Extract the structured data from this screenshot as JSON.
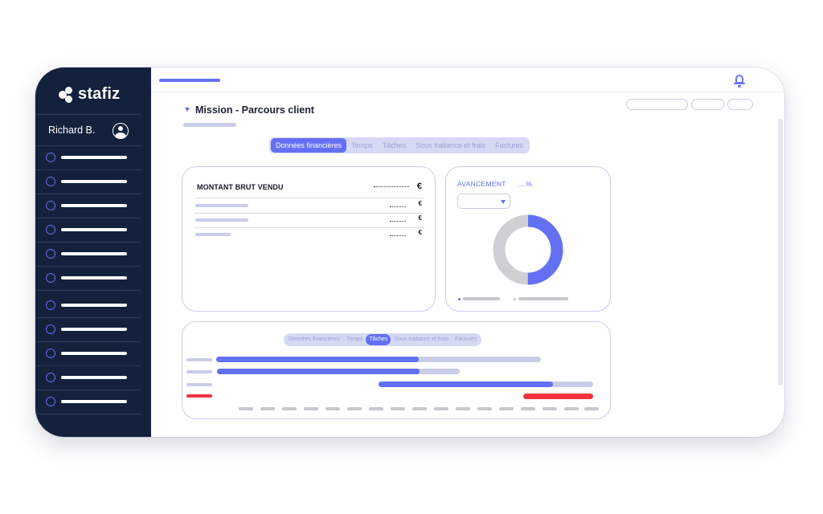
{
  "app": {
    "logo_text": "stafiz"
  },
  "user": {
    "name": "Richard B."
  },
  "sidebar": {
    "group1_count": 6,
    "group2_count": 5
  },
  "header": {
    "mission_title": "Mission - Parcours client"
  },
  "tabs": [
    {
      "label": "Données financières",
      "active": true
    },
    {
      "label": "Temps",
      "active": false
    },
    {
      "label": "Tâches",
      "active": false
    },
    {
      "label": "Sous traitance et frais",
      "active": false
    },
    {
      "label": "Factures",
      "active": false
    }
  ],
  "financial_card": {
    "title": "MONTANT BRUT VENDU",
    "currency": "€",
    "rows": [
      {
        "currency": "€"
      },
      {
        "currency": "€"
      },
      {
        "currency": "€"
      }
    ]
  },
  "avancement_card": {
    "label": "AVANCEMENT",
    "percent_placeholder": "....%",
    "donut_progress": 0.5,
    "colors": {
      "progress": "#6370f3",
      "remaining": "#cfcfd4"
    }
  },
  "gantt_card": {
    "tabs": [
      {
        "label": "Données financières",
        "active": false
      },
      {
        "label": "Temps",
        "active": false
      },
      {
        "label": "Tâches",
        "active": true
      },
      {
        "label": "Sous traitance et frais",
        "active": false
      },
      {
        "label": "Factures",
        "active": false
      }
    ]
  },
  "colors": {
    "accent": "#6370f3",
    "sidebar": "#13213d",
    "alert": "#f2323f"
  }
}
